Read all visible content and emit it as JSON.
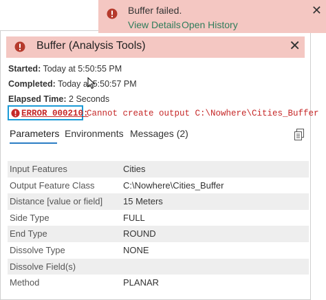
{
  "toast": {
    "title": "Buffer failed.",
    "view_details": "View Details",
    "open_history": "Open History",
    "close_glyph": "✕",
    "icon": "error-icon"
  },
  "dialog": {
    "title": "Buffer (Analysis Tools)",
    "close_glyph": "✕",
    "icon": "error-icon",
    "started_label": "Started:",
    "started_value": "Today at 5:50:55 PM",
    "completed_label": "Completed:",
    "completed_value": "Today at 5:50:57 PM",
    "elapsed_label": "Elapsed Time:",
    "elapsed_value": "2 Seconds",
    "error_code": "ERROR 000210:",
    "error_message": "Cannot create output C:\\Nowhere\\Cities_Buffer",
    "tabs": [
      {
        "label": "Parameters",
        "active": true
      },
      {
        "label": "Environments",
        "active": false
      },
      {
        "label": "Messages (2)",
        "active": false
      }
    ],
    "parameters": [
      {
        "name": "Input Features",
        "value": "Cities"
      },
      {
        "name": "Output Feature Class",
        "value": "C:\\Nowhere\\Cities_Buffer"
      },
      {
        "name": "Distance [value or field]",
        "value": "15 Meters"
      },
      {
        "name": "Side Type",
        "value": "FULL"
      },
      {
        "name": "End Type",
        "value": "ROUND"
      },
      {
        "name": "Dissolve Type",
        "value": "NONE"
      },
      {
        "name": "Dissolve Field(s)",
        "value": ""
      },
      {
        "name": "Method",
        "value": "PLANAR"
      }
    ]
  },
  "colors": {
    "error_bg": "#f4c7c2",
    "error_red": "#c62828",
    "link_green": "#2f7c5a",
    "accent_blue": "#2a7cc4",
    "highlight_box": "#1a9ad6"
  }
}
